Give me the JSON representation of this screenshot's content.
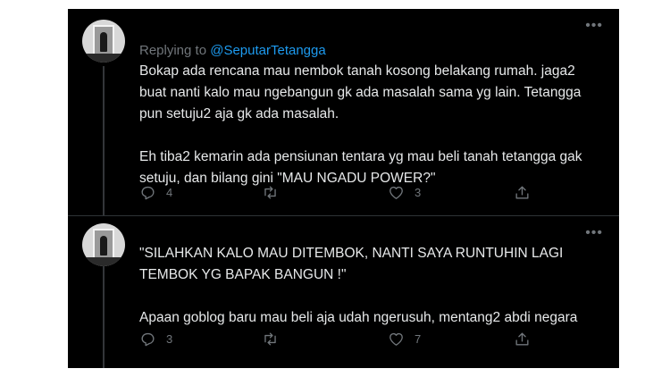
{
  "colors": {
    "background": "#000000",
    "text": "#e7e9ea",
    "muted": "#71767b",
    "link": "#1d9bf0",
    "divider": "#2f3336"
  },
  "icons": {
    "more": "more-icon",
    "reply": "reply-icon",
    "retweet": "retweet-icon",
    "like": "heart-icon",
    "share": "share-icon"
  },
  "tweets": [
    {
      "replying_prefix": "Replying to ",
      "replying_handle": "@SeputarTetangga",
      "text": "Bokap ada rencana mau nembok tanah kosong belakang rumah. jaga2\nbuat nanti kalo mau ngebangun gk ada masalah sama yg lain. Tetangga\npun setuju2 aja gk ada masalah.\n\nEh tiba2 kemarin ada pensiunan tentara yg mau beli tanah tetangga gak\nsetuju, dan bilang gini \"MAU NGADU POWER?\"",
      "replies": "4",
      "retweets": "",
      "likes": "3"
    },
    {
      "text": "\"SILAHKAN KALO MAU DITEMBOK, NANTI SAYA RUNTUHIN LAGI\nTEMBOK YG BAPAK BANGUN !\"\n\nApaan goblog baru mau beli aja udah ngerusuh, mentang2 abdi negara",
      "replies": "3",
      "retweets": "",
      "likes": "7"
    }
  ]
}
